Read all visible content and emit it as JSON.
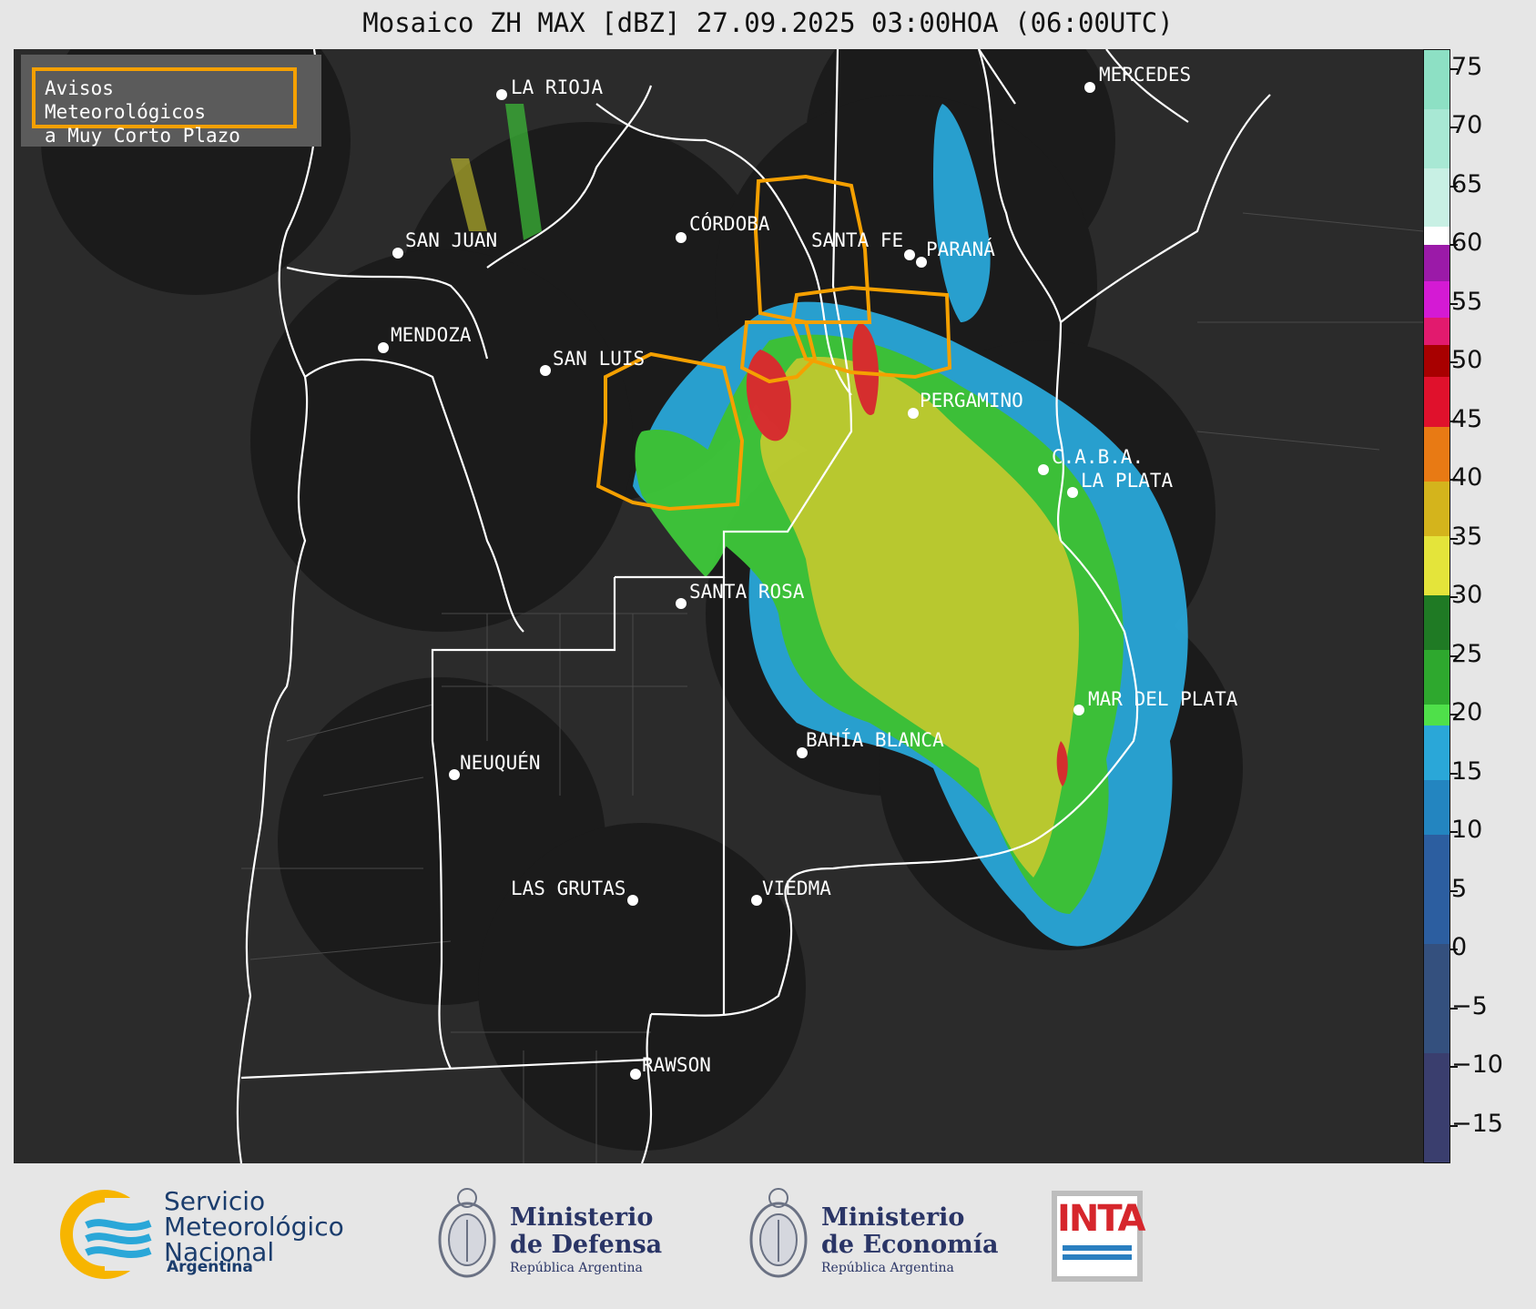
{
  "title": "Mosaico ZH MAX [dBZ] 27.09.2025 03:00HOA (06:00UTC)",
  "legend_box": {
    "line1": "Avisos Meteorológicos",
    "line2": "a Muy Corto Plazo",
    "border_color": "#f5a000"
  },
  "cities": [
    {
      "name": "LA RIOJA"
    },
    {
      "name": "MERCEDES"
    },
    {
      "name": "CÓRDOBA"
    },
    {
      "name": "SAN JUAN"
    },
    {
      "name": "SANTA FE"
    },
    {
      "name": "PARANÁ"
    },
    {
      "name": "MENDOZA"
    },
    {
      "name": "SAN LUIS"
    },
    {
      "name": "PERGAMINO"
    },
    {
      "name": "C.A.B.A."
    },
    {
      "name": "LA PLATA"
    },
    {
      "name": "SANTA ROSA"
    },
    {
      "name": "MAR DEL PLATA"
    },
    {
      "name": "BAHÍA BLANCA"
    },
    {
      "name": "NEUQUÉN"
    },
    {
      "name": "LAS GRUTAS"
    },
    {
      "name": "VIEDMA"
    },
    {
      "name": "RAWSON"
    }
  ],
  "colorbar": {
    "unit": "dBZ",
    "ticks": [
      "75",
      "70",
      "65",
      "60",
      "55",
      "50",
      "45",
      "40",
      "35",
      "30",
      "25",
      "20",
      "15",
      "10",
      "5",
      "0",
      "−5",
      "−10",
      "−15"
    ],
    "range": [
      -18,
      77
    ]
  },
  "footer": {
    "smn_line1": "Servicio",
    "smn_line2": "Meteorológico",
    "smn_line3": "Nacional",
    "smn_country": "Argentina",
    "defensa_line1": "Ministerio",
    "defensa_line2": "de Defensa",
    "defensa_line3": "República Argentina",
    "economia_line1": "Ministerio",
    "economia_line2": "de Economía",
    "economia_line3": "República Argentina",
    "inta": "INTA"
  }
}
